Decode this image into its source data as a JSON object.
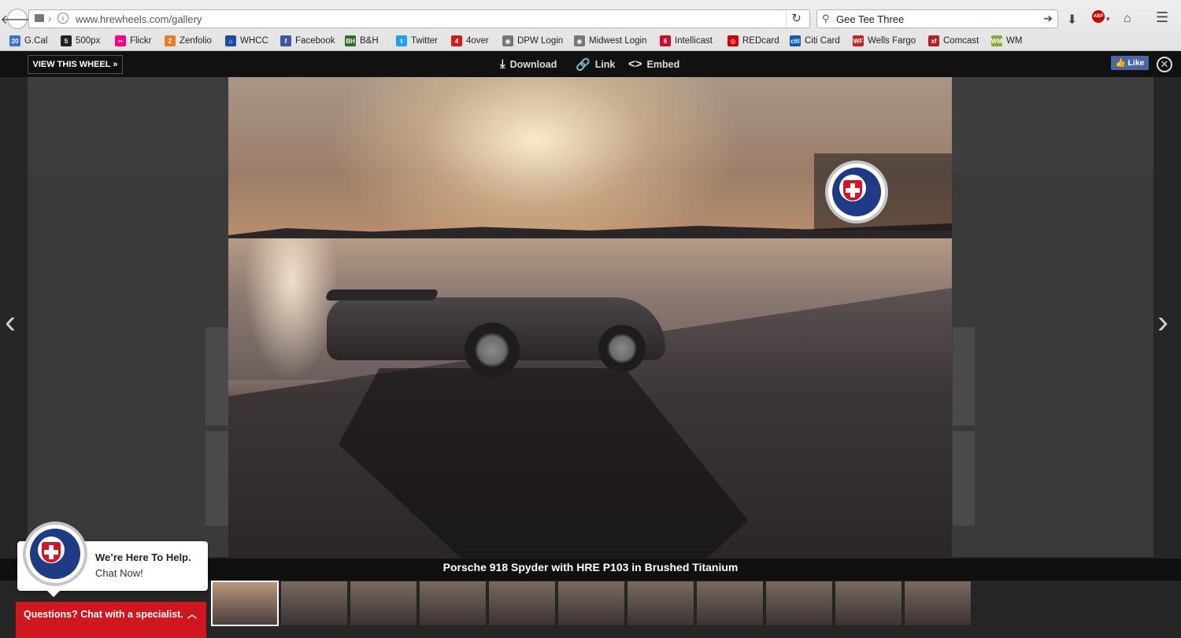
{
  "browser": {
    "url": "www.hrewheels.com/gallery",
    "search_query": "Gee Tee Three",
    "bookmarks": [
      {
        "label": "G.Cal",
        "badge": "20",
        "color": "#3b6fd0"
      },
      {
        "label": "500px",
        "badge": "5",
        "color": "#222222"
      },
      {
        "label": "Flickr",
        "badge": "••",
        "color": "#ff0084"
      },
      {
        "label": "Zenfolio",
        "badge": "Z",
        "color": "#e87b27"
      },
      {
        "label": "WHCC",
        "badge": "⌂",
        "color": "#1f4aa0"
      },
      {
        "label": "Facebook",
        "badge": "f",
        "color": "#3b5998"
      },
      {
        "label": "B&H",
        "badge": "BH",
        "color": "#2c6e2c"
      },
      {
        "label": "Twitter",
        "badge": "t",
        "color": "#1da1f2"
      },
      {
        "label": "4over",
        "badge": "4",
        "color": "#d21a1a"
      },
      {
        "label": "DPW Login",
        "badge": "◉",
        "color": "#777777"
      },
      {
        "label": "Midwest Login",
        "badge": "◉",
        "color": "#777777"
      },
      {
        "label": "Intellicast",
        "badge": "6",
        "color": "#c8102e"
      },
      {
        "label": "REDcard",
        "badge": "◎",
        "color": "#cc0000"
      },
      {
        "label": "Citi Card",
        "badge": "citi",
        "color": "#0a5cb7"
      },
      {
        "label": "Wells Fargo",
        "badge": "WF",
        "color": "#c81f1f"
      },
      {
        "label": "Comcast",
        "badge": "xf",
        "color": "#b81e1e"
      },
      {
        "label": "WM",
        "badge": "WM",
        "color": "#8aa83a"
      }
    ]
  },
  "toolbar": {
    "view_wheel": "VIEW THIS WHEEL »",
    "download": "Download",
    "link": "Link",
    "embed": "Embed",
    "fb_like": "Like"
  },
  "gallery": {
    "caption": "Porsche 918 Spyder with HRE P103 in Brushed Titanium",
    "thumbnail_count": 11,
    "active_thumbnail": 0
  },
  "chat": {
    "bubble_line1": "We’re Here To Help.",
    "bubble_line2": "Chat Now!",
    "bar_text": "Questions? Chat with a specialist."
  },
  "colors": {
    "chat_red": "#d0161e",
    "hre_blue": "#1f3b85",
    "fb_blue": "#4a67a6"
  }
}
